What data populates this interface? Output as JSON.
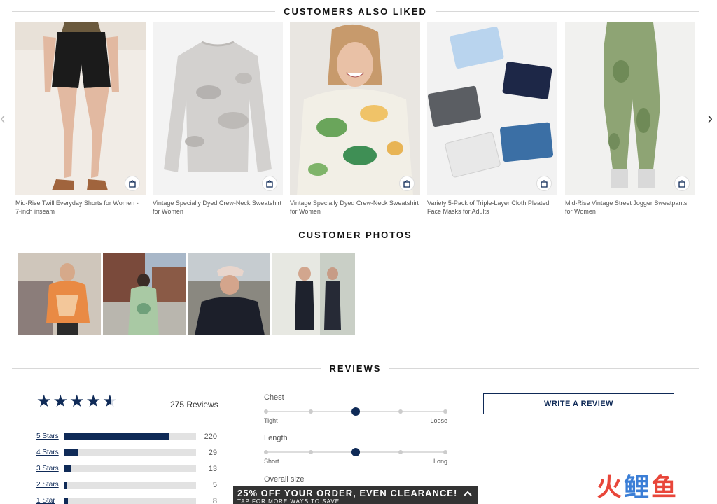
{
  "sections": {
    "customers_also_liked": "CUSTOMERS ALSO LIKED",
    "customer_photos": "CUSTOMER PHOTOS",
    "reviews": "REVIEWS"
  },
  "carousel": {
    "prev_icon": "chevron-left-icon",
    "next_icon": "chevron-right-icon",
    "products": [
      {
        "name": "Mid-Rise Twill Everyday Shorts for Women - 7-inch inseam"
      },
      {
        "name": "Vintage Specially Dyed Crew-Neck Sweatshirt for Women"
      },
      {
        "name": "Vintage Specially Dyed Crew-Neck Sweatshirt for Women"
      },
      {
        "name": "Variety 5-Pack of Triple-Layer Cloth Pleated Face Masks for Adults"
      },
      {
        "name": "Mid-Rise Vintage Street Jogger Sweatpants for Women"
      }
    ]
  },
  "reviews": {
    "rating": 4.5,
    "count_label": "275 Reviews",
    "histogram": [
      {
        "label": "5 Stars",
        "count": "220",
        "fraction": 0.8
      },
      {
        "label": "4 Stars",
        "count": "29",
        "fraction": 0.105
      },
      {
        "label": "3 Stars",
        "count": "13",
        "fraction": 0.047
      },
      {
        "label": "2 Stars",
        "count": "5",
        "fraction": 0.018
      },
      {
        "label": "1 Star",
        "count": "8",
        "fraction": 0.029
      }
    ],
    "fit": {
      "chest": {
        "title": "Chest",
        "low": "Tight",
        "high": "Loose",
        "value": 3,
        "steps": 5
      },
      "length": {
        "title": "Length",
        "low": "Short",
        "high": "Long",
        "value": 3,
        "steps": 5
      },
      "overall": {
        "title": "Overall size"
      }
    },
    "write_review": "WRITE A REVIEW"
  },
  "promo": {
    "title": "25% OFF YOUR ORDER, EVEN CLEARANCE!",
    "subtitle": "TAP FOR MORE WAYS TO SAVE"
  },
  "watermark": "火鲤鱼",
  "colors": {
    "brand_navy": "#0f2a57",
    "track_grey": "#e2e2e2",
    "promo_bg": "#333333"
  }
}
